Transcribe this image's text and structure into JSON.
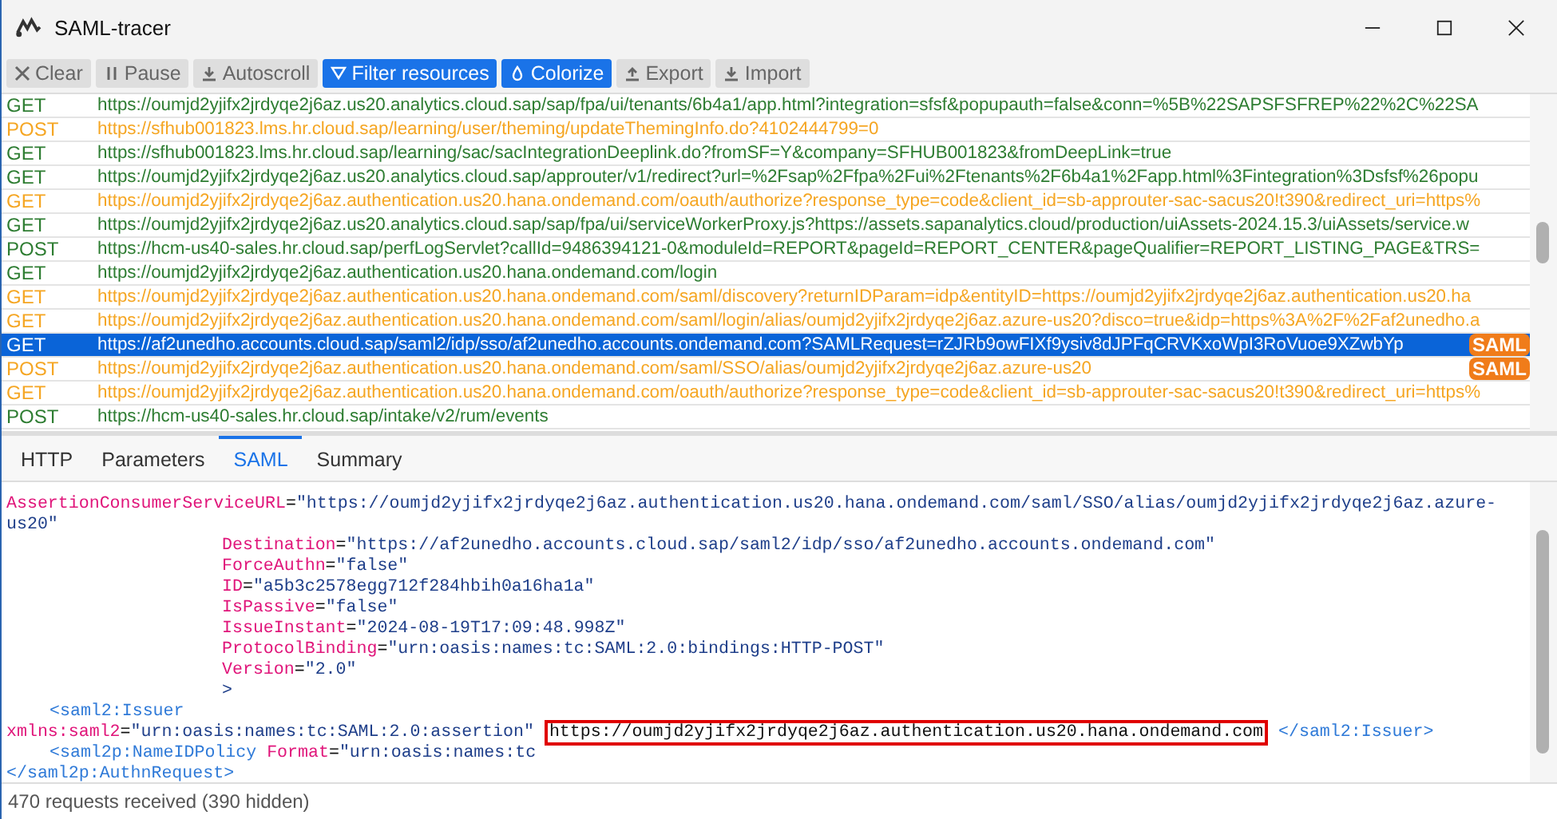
{
  "window": {
    "title": "SAML-tracer"
  },
  "toolbar": [
    {
      "label": "Clear",
      "active": false
    },
    {
      "label": "Pause",
      "active": false
    },
    {
      "label": "Autoscroll",
      "active": false
    },
    {
      "label": "Filter resources",
      "active": true
    },
    {
      "label": "Colorize",
      "active": true
    },
    {
      "label": "Export",
      "active": false
    },
    {
      "label": "Import",
      "active": false
    }
  ],
  "requests": [
    {
      "method": "GET",
      "url": "https://oumjd2yjifx2jrdyqe2j6az.us20.analytics.cloud.sap/sap/fpa/ui/tenants/6b4a1/app.html?integration=sfsf&popupauth=false&conn=%5B%22SAPSFSFREP%22%2C%22SA",
      "color": "#2e7d32",
      "selected": false
    },
    {
      "method": "POST",
      "url": "https://sfhub001823.lms.hr.cloud.sap/learning/user/theming/updateThemingInfo.do?4102444799=0",
      "color": "#f5a623",
      "selected": false
    },
    {
      "method": "GET",
      "url": "https://sfhub001823.lms.hr.cloud.sap/learning/sac/sacIntegrationDeeplink.do?fromSF=Y&company=SFHUB001823&fromDeepLink=true",
      "color": "#2e7d32",
      "selected": false
    },
    {
      "method": "GET",
      "url": "https://oumjd2yjifx2jrdyqe2j6az.us20.analytics.cloud.sap/approuter/v1/redirect?url=%2Fsap%2Ffpa%2Fui%2Ftenants%2F6b4a1%2Fapp.html%3Fintegration%3Dsfsf%26popu",
      "color": "#2e7d32",
      "selected": false
    },
    {
      "method": "GET",
      "url": "https://oumjd2yjifx2jrdyqe2j6az.authentication.us20.hana.ondemand.com/oauth/authorize?response_type=code&client_id=sb-approuter-sac-sacus20!t390&redirect_uri=https%",
      "color": "#f5a623",
      "selected": false
    },
    {
      "method": "GET",
      "url": "https://oumjd2yjifx2jrdyqe2j6az.us20.analytics.cloud.sap/sap/fpa/ui/serviceWorkerProxy.js?https://assets.sapanalytics.cloud/production/uiAssets-2024.15.3/uiAssets/service.w",
      "color": "#2e7d32",
      "selected": false
    },
    {
      "method": "POST",
      "url": "https://hcm-us40-sales.hr.cloud.sap/perfLogServlet?callId=9486394121-0&moduleId=REPORT&pageId=REPORT_CENTER&pageQualifier=REPORT_LISTING_PAGE&TRS=",
      "color": "#2e7d32",
      "selected": false
    },
    {
      "method": "GET",
      "url": "https://oumjd2yjifx2jrdyqe2j6az.authentication.us20.hana.ondemand.com/login",
      "color": "#2e7d32",
      "selected": false
    },
    {
      "method": "GET",
      "url": "https://oumjd2yjifx2jrdyqe2j6az.authentication.us20.hana.ondemand.com/saml/discovery?returnIDParam=idp&entityID=https://oumjd2yjifx2jrdyqe2j6az.authentication.us20.ha",
      "color": "#f5a623",
      "selected": false
    },
    {
      "method": "GET",
      "url": "https://oumjd2yjifx2jrdyqe2j6az.authentication.us20.hana.ondemand.com/saml/login/alias/oumjd2yjifx2jrdyqe2j6az.azure-us20?disco=true&idp=https%3A%2F%2Faf2unedho.a",
      "color": "#f5a623",
      "selected": false
    },
    {
      "method": "GET",
      "url": "https://af2unedho.accounts.cloud.sap/saml2/idp/sso/af2unedho.accounts.ondemand.com?SAMLRequest=rZJRb9owFIXf9ysiv8dJPFqCRVKxoWpI3RoVuoe9XZwbYp",
      "selected": true,
      "badge": "SAML"
    },
    {
      "method": "POST",
      "url": "https://oumjd2yjifx2jrdyqe2j6az.authentication.us20.hana.ondemand.com/saml/SSO/alias/oumjd2yjifx2jrdyqe2j6az.azure-us20",
      "color": "#f5a623",
      "selected": false,
      "badge": "SAML"
    },
    {
      "method": "GET",
      "url": "https://oumjd2yjifx2jrdyqe2j6az.authentication.us20.hana.ondemand.com/oauth/authorize?response_type=code&client_id=sb-approuter-sac-sacus20!t390&redirect_uri=https%",
      "color": "#f5a623",
      "selected": false
    },
    {
      "method": "POST",
      "url": "https://hcm-us40-sales.hr.cloud.sap/intake/v2/rum/events",
      "color": "#2e7d32",
      "selected": false
    }
  ],
  "tabs": [
    {
      "label": "HTTP",
      "selected": false
    },
    {
      "label": "Parameters",
      "selected": false
    },
    {
      "label": "SAML",
      "selected": true
    },
    {
      "label": "Summary",
      "selected": false
    }
  ],
  "code_lines": [
    {
      "kind": "top",
      "parts": [
        {
          "kind": "name",
          "text": "AssertionConsumerServiceURL"
        },
        {
          "kind": "plain",
          "text": "="
        },
        {
          "kind": "value",
          "text": "\"https://oumjd2yjifx2jrdyqe2j6az.authentication.us20.hana.ondemand.com/saml/SSO/alias/oumjd2yjifx2jrdyqe2j6az.azure-"
        }
      ]
    },
    {
      "kind": "top",
      "parts": [
        {
          "kind": "value",
          "text": "us20\""
        }
      ]
    },
    {
      "kind": "attr",
      "parts": [
        {
          "kind": "name",
          "text": "Destination"
        },
        {
          "kind": "plain",
          "text": "="
        },
        {
          "kind": "value",
          "text": "\"https://af2unedho.accounts.cloud.sap/saml2/idp/sso/af2unedho.accounts.ondemand.com\""
        }
      ]
    },
    {
      "kind": "attr",
      "parts": [
        {
          "kind": "name",
          "text": "ForceAuthn"
        },
        {
          "kind": "plain",
          "text": "="
        },
        {
          "kind": "value",
          "text": "\"false\""
        }
      ]
    },
    {
      "kind": "attr",
      "parts": [
        {
          "kind": "name",
          "text": "ID"
        },
        {
          "kind": "plain",
          "text": "="
        },
        {
          "kind": "value",
          "text": "\"a5b3c2578egg712f284hbih0a16ha1a\""
        }
      ]
    },
    {
      "kind": "attr",
      "parts": [
        {
          "kind": "name",
          "text": "IsPassive"
        },
        {
          "kind": "plain",
          "text": "="
        },
        {
          "kind": "value",
          "text": "\"false\""
        }
      ]
    },
    {
      "kind": "attr",
      "parts": [
        {
          "kind": "name",
          "text": "IssueInstant"
        },
        {
          "kind": "plain",
          "text": "="
        },
        {
          "kind": "value",
          "text": "\"2024-08-19T17:09:48.998Z\""
        }
      ]
    },
    {
      "kind": "attr",
      "parts": [
        {
          "kind": "name",
          "text": "ProtocolBinding"
        },
        {
          "kind": "plain",
          "text": "="
        },
        {
          "kind": "value",
          "text": "\"urn:oasis:names:tc:SAML:2.0:bindings:HTTP-POST\""
        }
      ]
    },
    {
      "kind": "attr",
      "parts": [
        {
          "kind": "name",
          "text": "Version"
        },
        {
          "kind": "plain",
          "text": "="
        },
        {
          "kind": "value",
          "text": "\"2.0\""
        }
      ]
    },
    {
      "kind": "attr",
      "parts": [
        {
          "kind": "value",
          "text": ">"
        }
      ]
    },
    {
      "kind": "child",
      "parts": [
        {
          "kind": "tag",
          "text": "<saml2:Issuer"
        }
      ]
    },
    {
      "kind": "top",
      "parts": [
        {
          "kind": "name",
          "text": "xmlns:saml2"
        },
        {
          "kind": "plain",
          "text": "="
        },
        {
          "kind": "value",
          "text": "\"urn:oasis:names:tc:SAML:2.0:assertion\""
        },
        {
          "kind": "plain",
          "text": "https://oumjd2yjifx2jrdyqe2j6az.authentication.us20.hana.ondemand.com",
          "highlighted": true
        },
        {
          "kind": "tag",
          "text": "</saml2:Issuer>"
        }
      ]
    },
    {
      "kind": "child",
      "parts": [
        {
          "kind": "tag",
          "text": "<saml2p:NameIDPolicy"
        },
        {
          "kind": "name",
          "text": "Format"
        },
        {
          "kind": "plain",
          "text": "="
        },
        {
          "kind": "value",
          "text": "\"urn:oasis:names:tc"
        }
      ]
    },
    {
      "kind": "top",
      "parts": [
        {
          "kind": "tag",
          "text": "</saml2p:AuthnRequest>"
        }
      ]
    }
  ],
  "status_bar": "470 requests received (390 hidden)"
}
